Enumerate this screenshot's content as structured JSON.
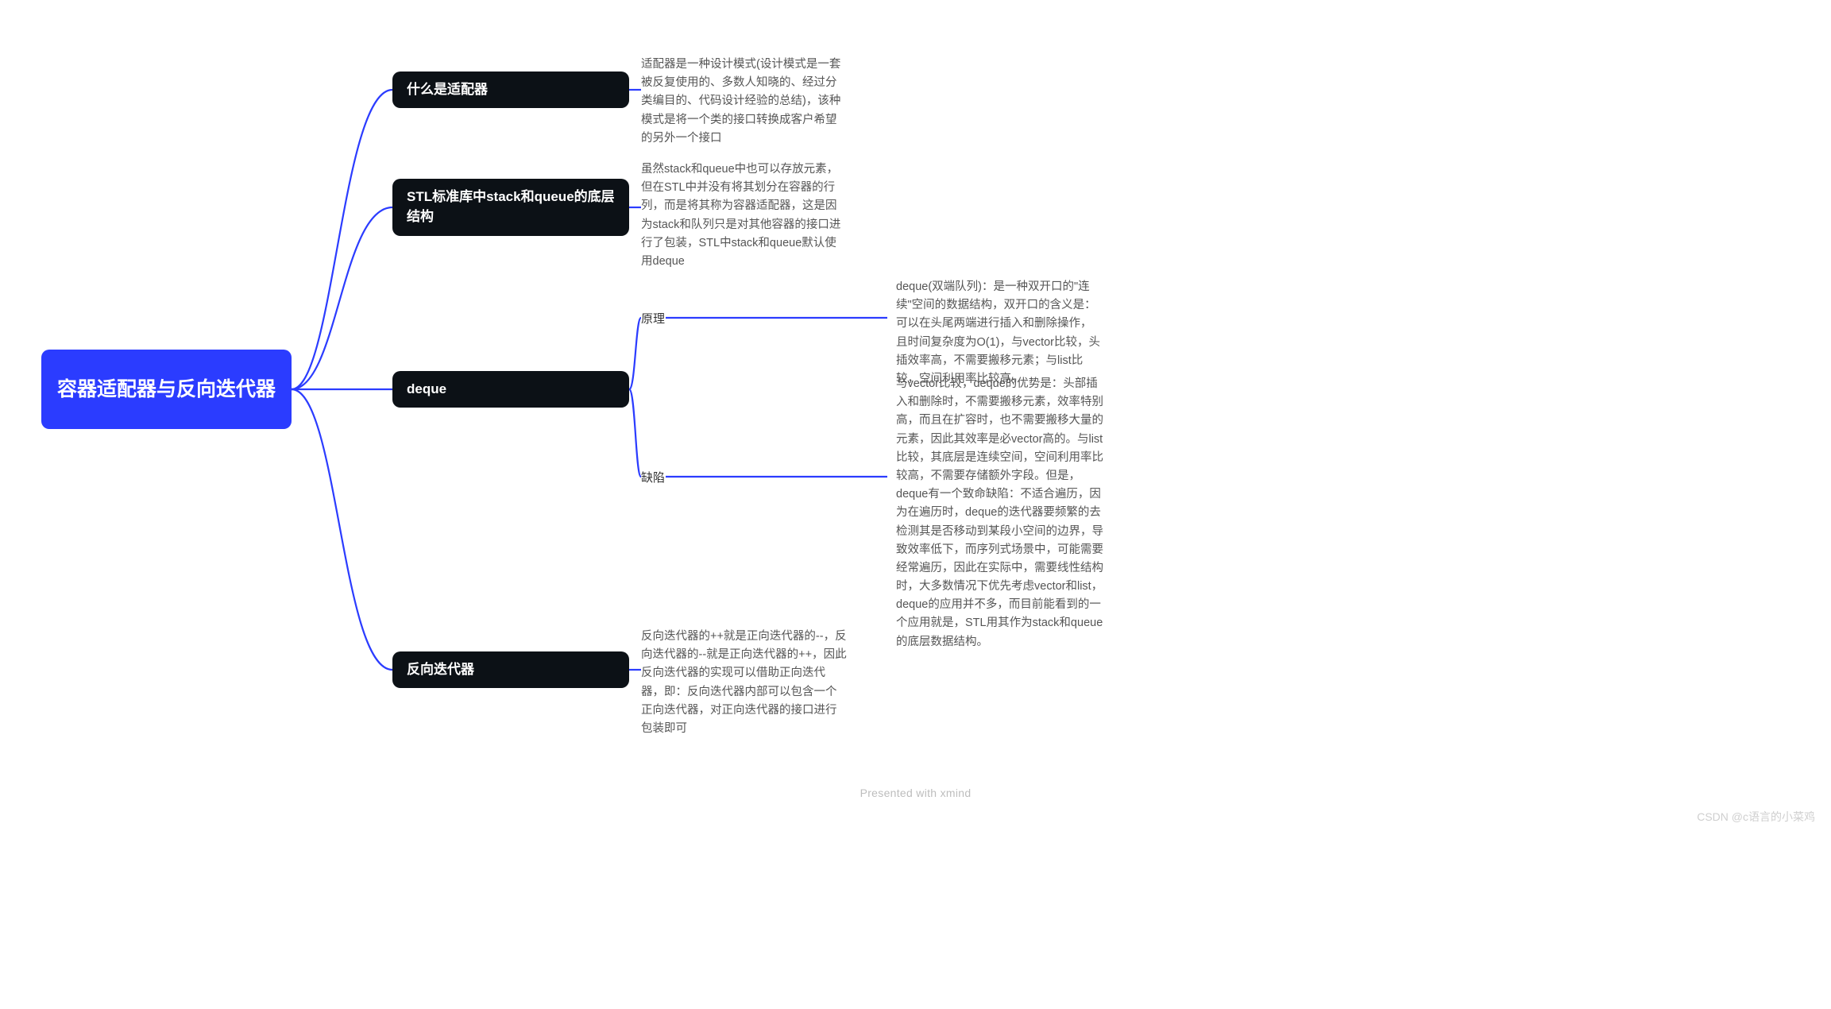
{
  "root": "容器适配器与反向迭代器",
  "branches": {
    "b1": {
      "title": "什么是适配器",
      "desc": "适配器是一种设计模式(设计模式是一套被反复使用的、多数人知晓的、经过分类编目的、代码设计经验的总结)，该种模式是将一个类的接口转换成客户希望的另外一个接口"
    },
    "b2": {
      "title": "STL标准库中stack和queue的底层结构",
      "desc": "虽然stack和queue中也可以存放元素，但在STL中并没有将其划分在容器的行列，而是将其称为容器适配器，这是因为stack和队列只是对其他容器的接口进行了包装，STL中stack和queue默认使用deque"
    },
    "b3": {
      "title": "deque",
      "sub1": {
        "label": "原理",
        "desc": "deque(双端队列)：是一种双开口的\"连续\"空间的数据结构，双开口的含义是：可以在头尾两端进行插入和删除操作，且时间复杂度为O(1)，与vector比较，头插效率高，不需要搬移元素；与list比较，空间利用率比较高。"
      },
      "sub2": {
        "label": "缺陷",
        "desc": "与vector比较，deque的优势是：头部插入和删除时，不需要搬移元素，效率特别高，而且在扩容时，也不需要搬移大量的元素，因此其效率是必vector高的。与list比较，其底层是连续空间，空间利用率比较高，不需要存储额外字段。但是，deque有一个致命缺陷：不适合遍历，因为在遍历时，deque的迭代器要频繁的去检测其是否移动到某段小空间的边界，导致效率低下，而序列式场景中，可能需要经常遍历，因此在实际中，需要线性结构时，大多数情况下优先考虑vector和list，deque的应用并不多，而目前能看到的一个应用就是，STL用其作为stack和queue的底层数据结构。"
      }
    },
    "b4": {
      "title": "反向迭代器",
      "desc": "反向迭代器的++就是正向迭代器的--，反向迭代器的--就是正向迭代器的++，因此反向迭代器的实现可以借助正向迭代器，即：反向迭代器内部可以包含一个正向迭代器，对正向迭代器的接口进行包装即可"
    }
  },
  "footer": "Presented with xmind",
  "watermark": "CSDN @c语言的小菜鸡"
}
